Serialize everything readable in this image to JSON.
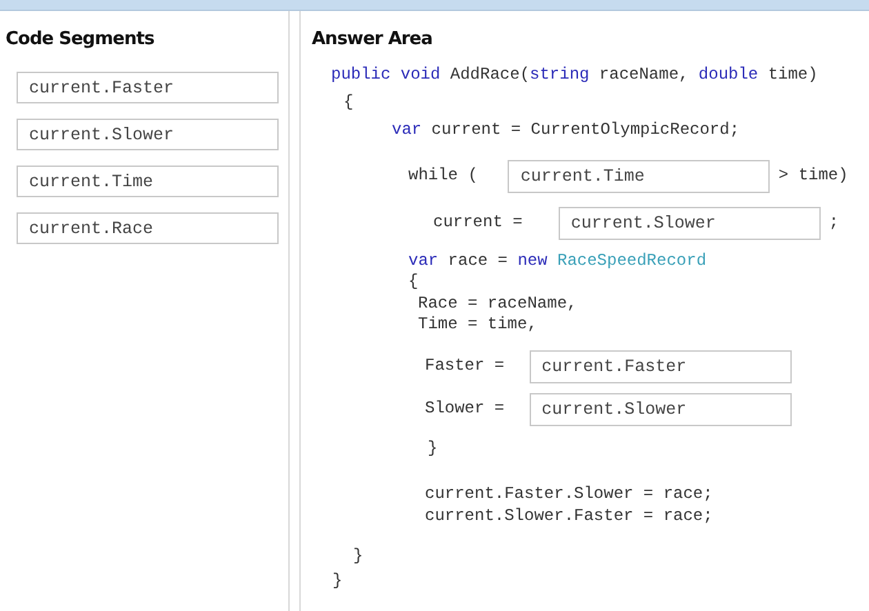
{
  "code_segments": {
    "title": "Code Segments",
    "items": [
      "current.Faster",
      "current.Slower",
      "current.Time",
      "current.Race"
    ]
  },
  "answer_area": {
    "title": "Answer Area",
    "lines": [
      [
        {
          "kind": "keyword",
          "text": "public void"
        },
        {
          "kind": "plain",
          "text": "AddRace("
        },
        {
          "kind": "keyword",
          "text": "string",
          "attached": true
        },
        {
          "kind": "plain",
          "text": "raceName,"
        },
        {
          "kind": "keyword",
          "text": "double"
        },
        {
          "kind": "plain",
          "text": "time)"
        }
      ],
      [
        {
          "kind": "plain",
          "text": "{"
        }
      ],
      [
        {
          "kind": "keyword",
          "text": "var"
        },
        {
          "kind": "plain",
          "text": "current = CurrentOlympicRecord;"
        }
      ],
      [
        {
          "kind": "plain",
          "text": "while ("
        },
        {
          "kind": "slot",
          "text": "current.Time"
        },
        {
          "kind": "plain",
          "text": "> time)"
        }
      ],
      [
        {
          "kind": "plain",
          "text": "current ="
        },
        {
          "kind": "slot",
          "text": "current.Slower"
        },
        {
          "kind": "plain",
          "text": ";"
        }
      ],
      [
        {
          "kind": "keyword",
          "text": "var"
        },
        {
          "kind": "plain",
          "text": "race ="
        },
        {
          "kind": "keyword",
          "text": "new"
        },
        {
          "kind": "type",
          "text": "RaceSpeedRecord"
        }
      ],
      [
        {
          "kind": "plain",
          "text": "{"
        }
      ],
      [
        {
          "kind": "plain",
          "text": "Race = raceName,"
        }
      ],
      [
        {
          "kind": "plain",
          "text": "Time = time,"
        }
      ],
      [
        {
          "kind": "plain",
          "text": "Faster ="
        },
        {
          "kind": "slot",
          "text": "current.Faster"
        }
      ],
      [
        {
          "kind": "plain",
          "text": "Slower ="
        },
        {
          "kind": "slot",
          "text": "current.Slower"
        }
      ],
      [
        {
          "kind": "plain",
          "text": "}"
        }
      ],
      [
        {
          "kind": "plain",
          "text": "current.Faster.Slower = race;"
        }
      ],
      [
        {
          "kind": "plain",
          "text": "current.Slower.Faster = race;"
        }
      ],
      [
        {
          "kind": "plain",
          "text": "}"
        }
      ],
      [
        {
          "kind": "plain",
          "text": "}"
        }
      ]
    ]
  }
}
